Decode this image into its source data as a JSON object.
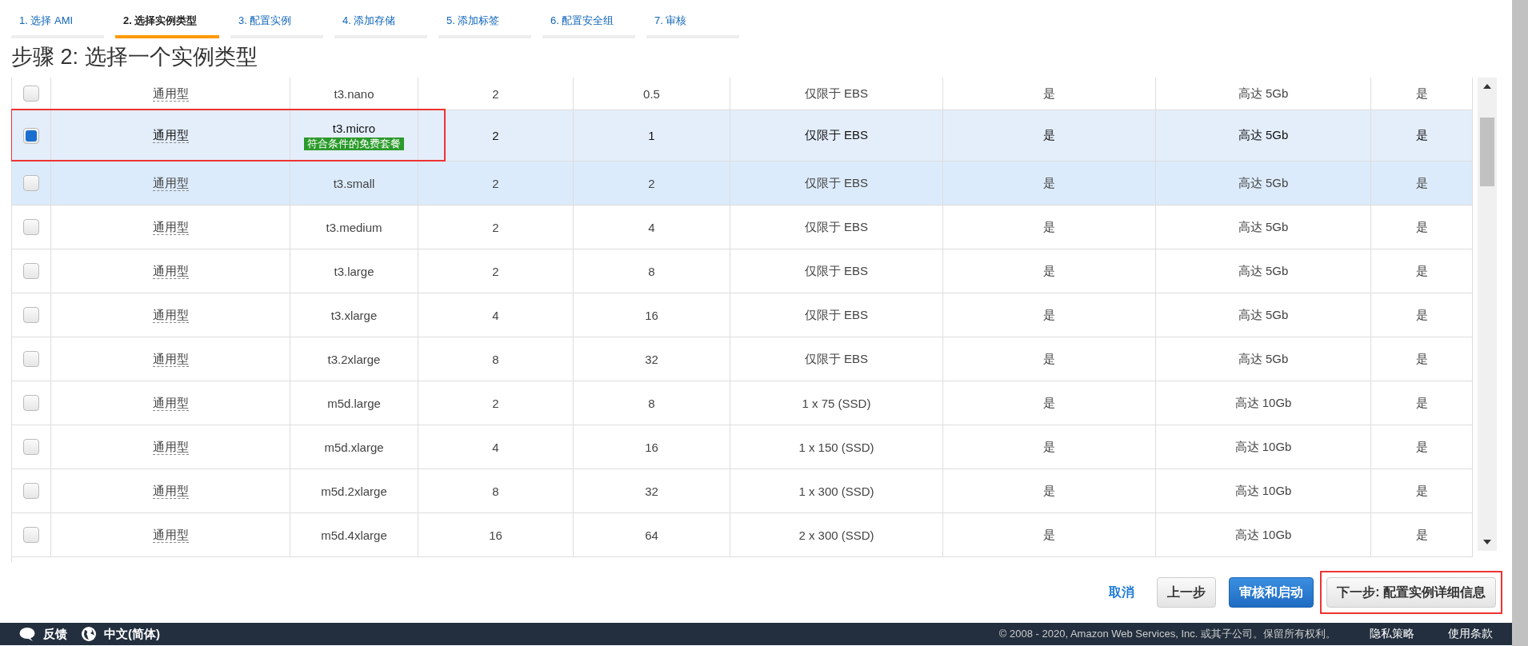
{
  "steps": [
    {
      "label": "1. 选择 AMI",
      "selected": false
    },
    {
      "label": "2. 选择实例类型",
      "selected": true
    },
    {
      "label": "3. 配置实例",
      "selected": false
    },
    {
      "label": "4. 添加存储",
      "selected": false
    },
    {
      "label": "5. 添加标签",
      "selected": false
    },
    {
      "label": "6. 配置安全组",
      "selected": false
    },
    {
      "label": "7. 审核",
      "selected": false
    }
  ],
  "heading": "步骤 2: 选择一个实例类型",
  "rows": [
    {
      "kind": "partial",
      "checked": false,
      "selected": false,
      "hovered": false,
      "outlined": false,
      "family": "通用型",
      "type": "t3.nano",
      "vcpu": "2",
      "memory": "0.5",
      "storage": "仅限于 EBS",
      "ebs_optimized": "是",
      "network": "高达 5Gb",
      "ipv6": "是"
    },
    {
      "kind": "full",
      "checked": true,
      "selected": true,
      "hovered": false,
      "outlined": true,
      "family": "通用型",
      "type": "t3.micro",
      "badge": "符合条件的免费套餐",
      "vcpu": "2",
      "memory": "1",
      "storage": "仅限于 EBS",
      "ebs_optimized": "是",
      "network": "高达 5Gb",
      "ipv6": "是"
    },
    {
      "kind": "full",
      "checked": false,
      "selected": false,
      "hovered": true,
      "outlined": false,
      "family": "通用型",
      "type": "t3.small",
      "vcpu": "2",
      "memory": "2",
      "storage": "仅限于 EBS",
      "ebs_optimized": "是",
      "network": "高达 5Gb",
      "ipv6": "是"
    },
    {
      "kind": "full",
      "checked": false,
      "selected": false,
      "hovered": false,
      "outlined": false,
      "family": "通用型",
      "type": "t3.medium",
      "vcpu": "2",
      "memory": "4",
      "storage": "仅限于 EBS",
      "ebs_optimized": "是",
      "network": "高达 5Gb",
      "ipv6": "是"
    },
    {
      "kind": "full",
      "checked": false,
      "selected": false,
      "hovered": false,
      "outlined": false,
      "family": "通用型",
      "type": "t3.large",
      "vcpu": "2",
      "memory": "8",
      "storage": "仅限于 EBS",
      "ebs_optimized": "是",
      "network": "高达 5Gb",
      "ipv6": "是"
    },
    {
      "kind": "full",
      "checked": false,
      "selected": false,
      "hovered": false,
      "outlined": false,
      "family": "通用型",
      "type": "t3.xlarge",
      "vcpu": "4",
      "memory": "16",
      "storage": "仅限于 EBS",
      "ebs_optimized": "是",
      "network": "高达 5Gb",
      "ipv6": "是"
    },
    {
      "kind": "full",
      "checked": false,
      "selected": false,
      "hovered": false,
      "outlined": false,
      "family": "通用型",
      "type": "t3.2xlarge",
      "vcpu": "8",
      "memory": "32",
      "storage": "仅限于 EBS",
      "ebs_optimized": "是",
      "network": "高达 5Gb",
      "ipv6": "是"
    },
    {
      "kind": "full",
      "checked": false,
      "selected": false,
      "hovered": false,
      "outlined": false,
      "family": "通用型",
      "type": "m5d.large",
      "vcpu": "2",
      "memory": "8",
      "storage": "1 x 75 (SSD)",
      "ebs_optimized": "是",
      "network": "高达 10Gb",
      "ipv6": "是"
    },
    {
      "kind": "full",
      "checked": false,
      "selected": false,
      "hovered": false,
      "outlined": false,
      "family": "通用型",
      "type": "m5d.xlarge",
      "vcpu": "4",
      "memory": "16",
      "storage": "1 x 150 (SSD)",
      "ebs_optimized": "是",
      "network": "高达 10Gb",
      "ipv6": "是"
    },
    {
      "kind": "full",
      "checked": false,
      "selected": false,
      "hovered": false,
      "outlined": false,
      "family": "通用型",
      "type": "m5d.2xlarge",
      "vcpu": "8",
      "memory": "32",
      "storage": "1 x 300 (SSD)",
      "ebs_optimized": "是",
      "network": "高达 10Gb",
      "ipv6": "是"
    },
    {
      "kind": "full",
      "checked": false,
      "selected": false,
      "hovered": false,
      "outlined": false,
      "family": "通用型",
      "type": "m5d.4xlarge",
      "vcpu": "16",
      "memory": "64",
      "storage": "2 x 300 (SSD)",
      "ebs_optimized": "是",
      "network": "高达 10Gb",
      "ipv6": "是"
    }
  ],
  "actions": [
    {
      "kind": "link",
      "label": "取消",
      "outlined": false
    },
    {
      "kind": "default",
      "label": "上一步",
      "outlined": false
    },
    {
      "kind": "primary",
      "label": "审核和启动",
      "outlined": false
    },
    {
      "kind": "default",
      "label": "下一步: 配置实例详细信息",
      "outlined": true
    }
  ],
  "footer": {
    "feedback": "反馈",
    "language": "中文(简体)",
    "copyright": "© 2008 - 2020, Amazon Web Services, Inc. 或其子公司。保留所有权利。",
    "links": [
      "隐私策略",
      "使用条款"
    ]
  }
}
